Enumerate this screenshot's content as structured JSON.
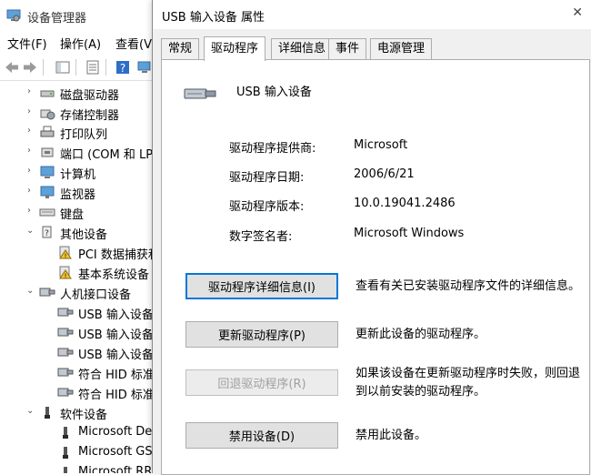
{
  "device_manager": {
    "title": "设备管理器",
    "menu": [
      "文件(F)",
      "操作(A)",
      "查看(V"
    ],
    "tree": [
      {
        "label": "磁盘驱动器",
        "icon": "disk-icon",
        "level": 1,
        "expanded": false
      },
      {
        "label": "存储控制器",
        "icon": "storage-controller-icon",
        "level": 1,
        "expanded": false
      },
      {
        "label": "打印队列",
        "icon": "printer-icon",
        "level": 1,
        "expanded": false
      },
      {
        "label": "端口 (COM 和 LP",
        "icon": "port-icon",
        "level": 1,
        "expanded": false
      },
      {
        "label": "计算机",
        "icon": "computer-icon",
        "level": 1,
        "expanded": false
      },
      {
        "label": "监视器",
        "icon": "monitor-icon",
        "level": 1,
        "expanded": false
      },
      {
        "label": "键盘",
        "icon": "keyboard-icon",
        "level": 1,
        "expanded": false
      },
      {
        "label": "其他设备",
        "icon": "unknown-device-icon",
        "level": 1,
        "expanded": true
      },
      {
        "label": "PCI 数据捕获和",
        "icon": "warning-device-icon",
        "level": 2
      },
      {
        "label": "基本系统设备",
        "icon": "warning-device-icon",
        "level": 2
      },
      {
        "label": "人机接口设备",
        "icon": "hid-icon",
        "level": 1,
        "expanded": true
      },
      {
        "label": "USB 输入设备",
        "icon": "hid-device-icon",
        "level": 2
      },
      {
        "label": "USB 输入设备",
        "icon": "hid-device-icon",
        "level": 2
      },
      {
        "label": "USB 输入设备",
        "icon": "hid-device-icon",
        "level": 2
      },
      {
        "label": "符合 HID 标准",
        "icon": "hid-device-icon",
        "level": 2
      },
      {
        "label": "符合 HID 标准",
        "icon": "hid-device-icon",
        "level": 2
      },
      {
        "label": "软件设备",
        "icon": "software-device-icon",
        "level": 1,
        "expanded": true
      },
      {
        "label": "Microsoft De",
        "icon": "software-device-icon",
        "level": 2
      },
      {
        "label": "Microsoft GS",
        "icon": "software-device-icon",
        "level": 2
      },
      {
        "label": "Microsoft RR",
        "icon": "software-device-icon",
        "level": 2
      }
    ]
  },
  "dialog": {
    "title": "USB 输入设备 属性",
    "close_glyph": "✕",
    "tabs": [
      "常规",
      "驱动程序",
      "详细信息",
      "事件",
      "电源管理"
    ],
    "active_tab": "驱动程序",
    "device_name": "USB 输入设备",
    "properties": [
      {
        "label": "驱动程序提供商:",
        "value": "Microsoft"
      },
      {
        "label": "驱动程序日期:",
        "value": "2006/6/21"
      },
      {
        "label": "驱动程序版本:",
        "value": "10.0.19041.2486"
      },
      {
        "label": "数字签名者:",
        "value": "Microsoft Windows"
      }
    ],
    "buttons": [
      {
        "label": "驱动程序详细信息(I)",
        "description": "查看有关已安装驱动程序文件的详细信息。",
        "enabled": true,
        "focused": true
      },
      {
        "label": "更新驱动程序(P)",
        "description": "更新此设备的驱动程序。",
        "enabled": true,
        "focused": false
      },
      {
        "label": "回退驱动程序(R)",
        "description": "如果该设备在更新驱动程序时失败，则回退到以前安装的驱动程序。",
        "enabled": false,
        "focused": false
      },
      {
        "label": "禁用设备(D)",
        "description": "禁用此设备。",
        "enabled": true,
        "focused": false
      }
    ]
  },
  "colors": {
    "focus_border": "#0078d7",
    "dialog_bg": "#f0f0f0",
    "disabled_text": "#a0a0a0"
  }
}
